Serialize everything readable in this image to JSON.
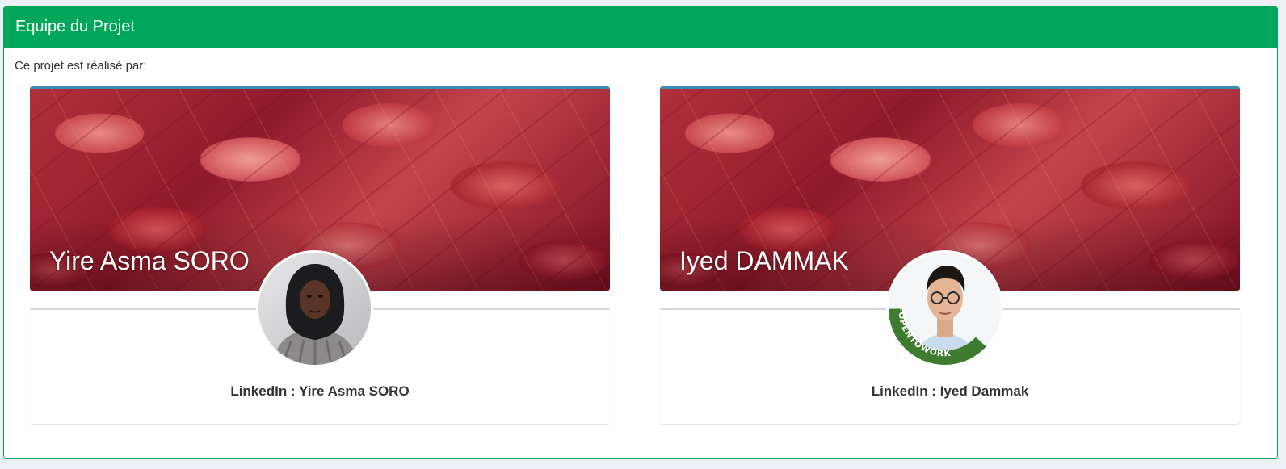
{
  "box": {
    "title": "Equipe du Projet",
    "intro": "Ce projet est réalisé par:"
  },
  "members": [
    {
      "name": "Yire Asma SORO",
      "linkedin": "LinkedIn : Yire Asma SORO",
      "avatar_icon": "profile-photo-woman-hijab"
    },
    {
      "name": "Iyed DAMMAK",
      "linkedin": "LinkedIn : Iyed Dammak",
      "avatar_icon": "profile-photo-man-glasses",
      "avatar_badge": "#OPENTOWORK"
    }
  ],
  "colors": {
    "header": "#00a65a",
    "banner_top_border": "#3c8dbc",
    "opentowork_ring": "#3e7b2f"
  }
}
